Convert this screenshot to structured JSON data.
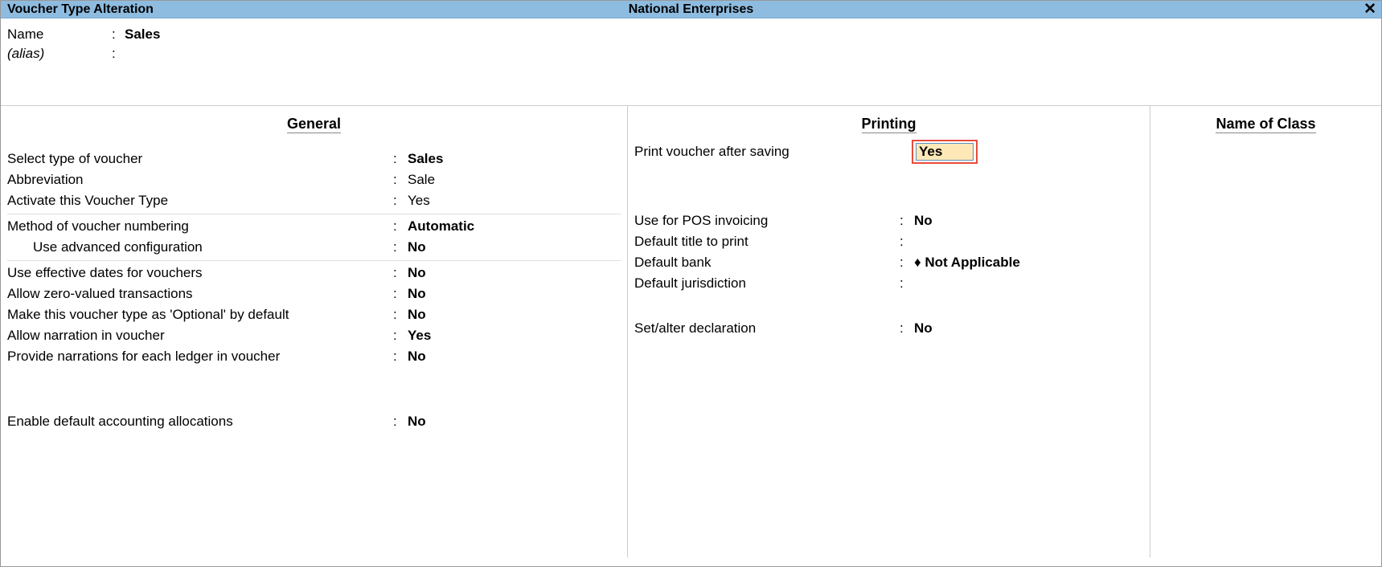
{
  "titlebar": {
    "left": "Voucher Type Alteration",
    "center": "National Enterprises"
  },
  "header": {
    "name_label": "Name",
    "name_value": "Sales",
    "alias_label": "(alias)",
    "alias_value": ""
  },
  "columns": {
    "general_heading": "General",
    "printing_heading": "Printing",
    "class_heading": "Name of Class"
  },
  "general": {
    "select_type_label": "Select type of voucher",
    "select_type_value": "Sales",
    "abbrev_label": "Abbreviation",
    "abbrev_value": "Sale",
    "activate_label": "Activate this Voucher Type",
    "activate_value": "Yes",
    "method_label": "Method of voucher numbering",
    "method_value": "Automatic",
    "adv_cfg_label": "Use advanced configuration",
    "adv_cfg_value": "No",
    "eff_dates_label": "Use effective dates for vouchers",
    "eff_dates_value": "No",
    "zero_val_label": "Allow zero-valued transactions",
    "zero_val_value": "No",
    "optional_label": "Make this voucher type as 'Optional' by default",
    "optional_value": "No",
    "narration_label": "Allow narration in voucher",
    "narration_value": "Yes",
    "narr_each_label": "Provide narrations for each ledger in voucher",
    "narr_each_value": "No",
    "def_alloc_label": "Enable default accounting allocations",
    "def_alloc_value": "No"
  },
  "printing": {
    "print_after_label": "Print voucher after saving",
    "print_after_value": "Yes",
    "pos_label": "Use for POS invoicing",
    "pos_value": "No",
    "title_label": "Default title to print",
    "title_value": "",
    "bank_label": "Default bank",
    "bank_value": "♦ Not Applicable",
    "juris_label": "Default jurisdiction",
    "juris_value": "",
    "decl_label": "Set/alter declaration",
    "decl_value": "No"
  }
}
